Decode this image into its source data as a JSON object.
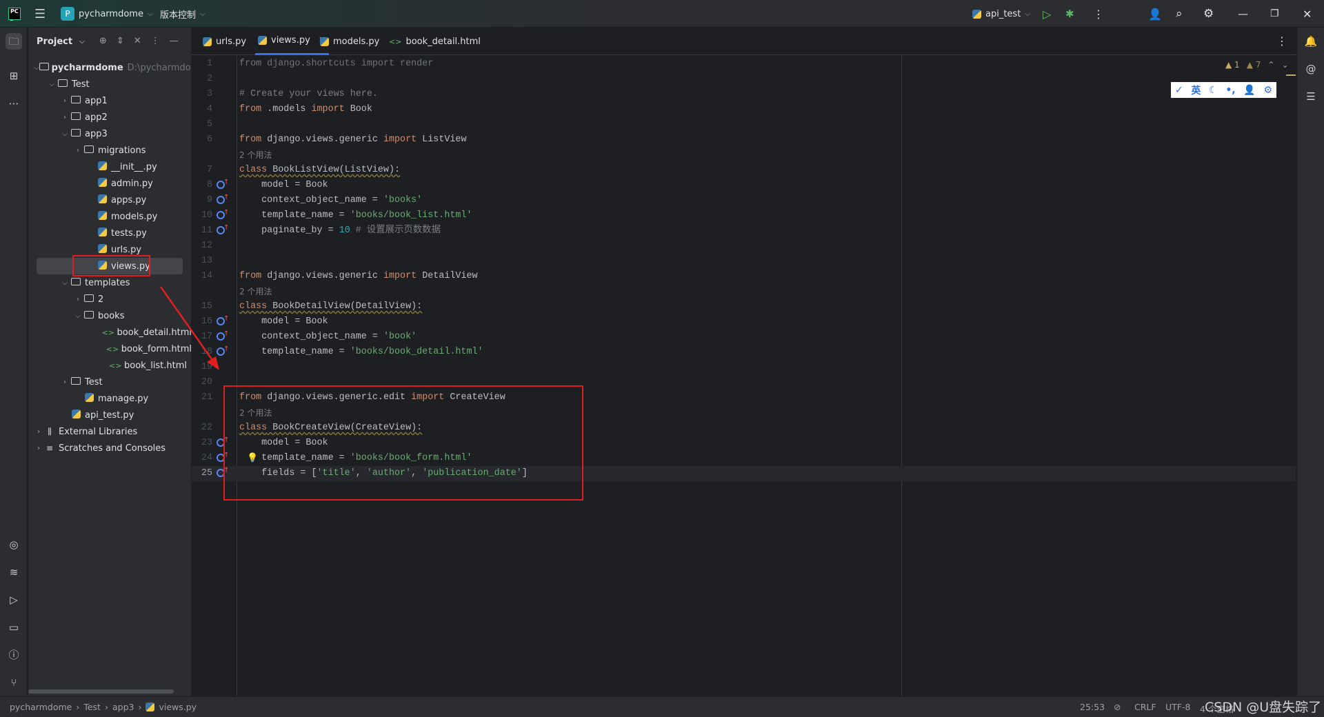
{
  "titlebar": {
    "project": "pycharmdome",
    "project_badge": "P",
    "vcs": "版本控制",
    "run_config": "api_test"
  },
  "panel": {
    "title": "Project"
  },
  "tree": [
    {
      "label": "pycharmdome",
      "hint": "D:\\pycharmdome",
      "depth": 0,
      "chev": "open",
      "icon": "folder",
      "bold": true
    },
    {
      "label": "Test",
      "depth": 1,
      "chev": "open",
      "icon": "folder"
    },
    {
      "label": "app1",
      "depth": 2,
      "chev": "closed",
      "icon": "package"
    },
    {
      "label": "app2",
      "depth": 2,
      "chev": "closed",
      "icon": "package"
    },
    {
      "label": "app3",
      "depth": 2,
      "chev": "open",
      "icon": "package"
    },
    {
      "label": "migrations",
      "depth": 3,
      "chev": "closed",
      "icon": "package"
    },
    {
      "label": "__init__.py",
      "depth": 4,
      "icon": "python"
    },
    {
      "label": "admin.py",
      "depth": 4,
      "icon": "python"
    },
    {
      "label": "apps.py",
      "depth": 4,
      "icon": "python"
    },
    {
      "label": "models.py",
      "depth": 4,
      "icon": "python"
    },
    {
      "label": "tests.py",
      "depth": 4,
      "icon": "python"
    },
    {
      "label": "urls.py",
      "depth": 4,
      "icon": "python"
    },
    {
      "label": "views.py",
      "depth": 4,
      "icon": "python",
      "selected": true
    },
    {
      "label": "templates",
      "depth": 2,
      "chev": "open",
      "icon": "folder"
    },
    {
      "label": "2",
      "depth": 3,
      "chev": "closed",
      "icon": "folder"
    },
    {
      "label": "books",
      "depth": 3,
      "chev": "open",
      "icon": "folder"
    },
    {
      "label": "book_detail.html",
      "depth": 5,
      "icon": "html"
    },
    {
      "label": "book_form.html",
      "depth": 5,
      "icon": "html"
    },
    {
      "label": "book_list.html",
      "depth": 5,
      "icon": "html"
    },
    {
      "label": "Test",
      "depth": 2,
      "chev": "closed",
      "icon": "folder"
    },
    {
      "label": "manage.py",
      "depth": 3,
      "icon": "python"
    },
    {
      "label": "api_test.py",
      "depth": 2,
      "icon": "python"
    },
    {
      "label": "External Libraries",
      "depth": 0,
      "chev": "closed",
      "icon": "library"
    },
    {
      "label": "Scratches and Consoles",
      "depth": 0,
      "chev": "closed",
      "icon": "scratch"
    }
  ],
  "tabs": [
    {
      "label": "urls.py",
      "icon": "python"
    },
    {
      "label": "views.py",
      "icon": "python",
      "active": true
    },
    {
      "label": "models.py",
      "icon": "python"
    },
    {
      "label": "book_detail.html",
      "icon": "html"
    }
  ],
  "inspections": {
    "errors": "1",
    "warnings": "7"
  },
  "ime_toolbar": [
    "✓",
    "英",
    "☾",
    "•,",
    "👤",
    "⚙"
  ],
  "code": [
    {
      "ln": "1",
      "t": [
        [
          "from django.shortcuts import render",
          "u"
        ]
      ]
    },
    {
      "ln": "2",
      "t": []
    },
    {
      "ln": "3",
      "t": [
        [
          "# Create your views here.",
          "c"
        ]
      ]
    },
    {
      "ln": "4",
      "t": [
        [
          "from",
          "k"
        ],
        [
          " .models ",
          ""
        ],
        [
          "import",
          "k"
        ],
        [
          " Book",
          ""
        ]
      ]
    },
    {
      "ln": "5",
      "t": []
    },
    {
      "ln": "6",
      "t": [
        [
          "from",
          "k"
        ],
        [
          " django.views.generic ",
          ""
        ],
        [
          "import",
          "k"
        ],
        [
          " ListView",
          ""
        ]
      ]
    },
    {
      "hint": "2 个用法"
    },
    {
      "ln": "7",
      "t": [
        [
          "class",
          "kw"
        ],
        [
          " BookListView(ListView):",
          "w"
        ]
      ]
    },
    {
      "ln": "8",
      "ov": true,
      "t": [
        [
          "    model = Book",
          ""
        ]
      ]
    },
    {
      "ln": "9",
      "ov": true,
      "t": [
        [
          "    context_object_name = ",
          ""
        ],
        [
          "'books'",
          "s"
        ]
      ]
    },
    {
      "ln": "10",
      "ov": true,
      "t": [
        [
          "    template_name = ",
          ""
        ],
        [
          "'books/book_list.html'",
          "s"
        ]
      ]
    },
    {
      "ln": "11",
      "ov": true,
      "t": [
        [
          "    paginate_by = ",
          ""
        ],
        [
          "10",
          "n"
        ],
        [
          " # 设置展示页数数据",
          "c"
        ]
      ]
    },
    {
      "ln": "12",
      "t": []
    },
    {
      "ln": "13",
      "t": []
    },
    {
      "ln": "14",
      "t": [
        [
          "from",
          "k"
        ],
        [
          " django.views.generic ",
          ""
        ],
        [
          "import",
          "k"
        ],
        [
          " DetailView",
          ""
        ]
      ]
    },
    {
      "hint": "2 个用法"
    },
    {
      "ln": "15",
      "t": [
        [
          "class",
          "kw"
        ],
        [
          " BookDetailView(DetailView):",
          "w"
        ]
      ]
    },
    {
      "ln": "16",
      "ov": true,
      "t": [
        [
          "    model = Book",
          ""
        ]
      ]
    },
    {
      "ln": "17",
      "ov": true,
      "t": [
        [
          "    context_object_name = ",
          ""
        ],
        [
          "'book'",
          "s"
        ]
      ]
    },
    {
      "ln": "18",
      "ov": true,
      "t": [
        [
          "    template_name = ",
          ""
        ],
        [
          "'books/book_detail.html'",
          "s"
        ]
      ]
    },
    {
      "ln": "19",
      "t": []
    },
    {
      "ln": "20",
      "t": []
    },
    {
      "ln": "21",
      "t": [
        [
          "from",
          "k"
        ],
        [
          " django.views.generic.edit ",
          ""
        ],
        [
          "import",
          "k"
        ],
        [
          " CreateView",
          ""
        ]
      ]
    },
    {
      "hint": "2 个用法"
    },
    {
      "ln": "22",
      "t": [
        [
          "class",
          "kw"
        ],
        [
          " BookCreateView(CreateView):",
          "w"
        ]
      ]
    },
    {
      "ln": "23",
      "ov": true,
      "t": [
        [
          "    model = Book",
          ""
        ]
      ]
    },
    {
      "ln": "24",
      "ov": true,
      "bulb": true,
      "t": [
        [
          "    template_name = ",
          ""
        ],
        [
          "'books/book_form.html'",
          "s"
        ]
      ]
    },
    {
      "ln": "25",
      "ov": true,
      "cur": true,
      "t": [
        [
          "    fields = [",
          ""
        ],
        [
          "'title'",
          "s"
        ],
        [
          ", ",
          ""
        ],
        [
          "'author'",
          "s"
        ],
        [
          ", ",
          ""
        ],
        [
          "'publication_date'",
          "s"
        ],
        [
          "]",
          ""
        ]
      ]
    }
  ],
  "statusbar": {
    "breadcrumb": [
      "pycharmdome",
      "Test",
      "app3",
      "views.py"
    ],
    "position": "25:53",
    "line_sep": "CRLF",
    "encoding": "UTF-8",
    "indent": "4 个空格"
  },
  "watermark": "CSDN @U盘失踪了"
}
